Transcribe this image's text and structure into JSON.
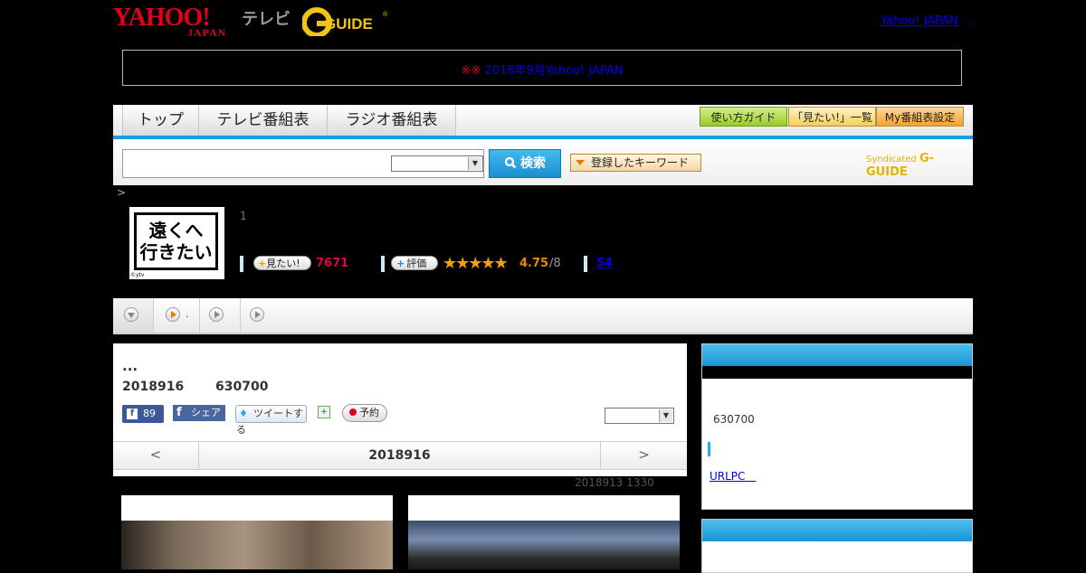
{
  "header": {
    "logo_yahoo": "YAHOO!",
    "logo_japan": "JAPAN",
    "logo_tv": "テレビ",
    "logo_gguide": "G-GUIDE",
    "top_link": "Yahoo! JAPAN",
    "top_link_suffix": ".",
    "mid_dot": "."
  },
  "notice": {
    "mark": "※※",
    "link": "2018年9月Yahoo! JAPAN　　　　　　"
  },
  "nav": {
    "tabs": [
      "トップ",
      "テレビ番組表",
      "ラジオ番組表"
    ],
    "guide_btn": "使い方ガイド",
    "mitai_list_btn": "「見たい!」一覧",
    "my_table_btn": "My番組表設定"
  },
  "search": {
    "input_value": "",
    "select_value": "",
    "button": "検索",
    "keyword_btn": "登録したキーワード",
    "syndicated": "Syndicated",
    "syndicated_brand": "G-GUIDE"
  },
  "breadcrumb": ">",
  "program": {
    "image_text_line1": "遠くへ",
    "image_text_line2": "行きたい",
    "image_credit": "©ytv",
    "episode_no": "1",
    "mitai_label": "見たい!",
    "mitai_count": "7671",
    "rating_label": "評価",
    "stars": "★★★★★",
    "rating_value": "4.75",
    "rating_max": "/8",
    "comment_count": "54"
  },
  "playbar": {
    "item2_text": "."
  },
  "main": {
    "title": "...",
    "air_date": "2018916",
    "air_time": "630700",
    "fb_count": "89",
    "fb_share": "シェア",
    "tweet": "ツイートする",
    "reserve": "予約",
    "select_value": "",
    "day_prev": "<",
    "day_date": "2018916",
    "day_next": ">",
    "updated": "2018913  1330"
  },
  "sidebar": {
    "box1_time": "630700",
    "box1_link": "URLPC　"
  },
  "colors": {
    "brand_red": "#e0001b",
    "accent_blue": "#16a0d8",
    "mitai_pink": "#e0004a",
    "rating_orange": "#e88a00"
  }
}
